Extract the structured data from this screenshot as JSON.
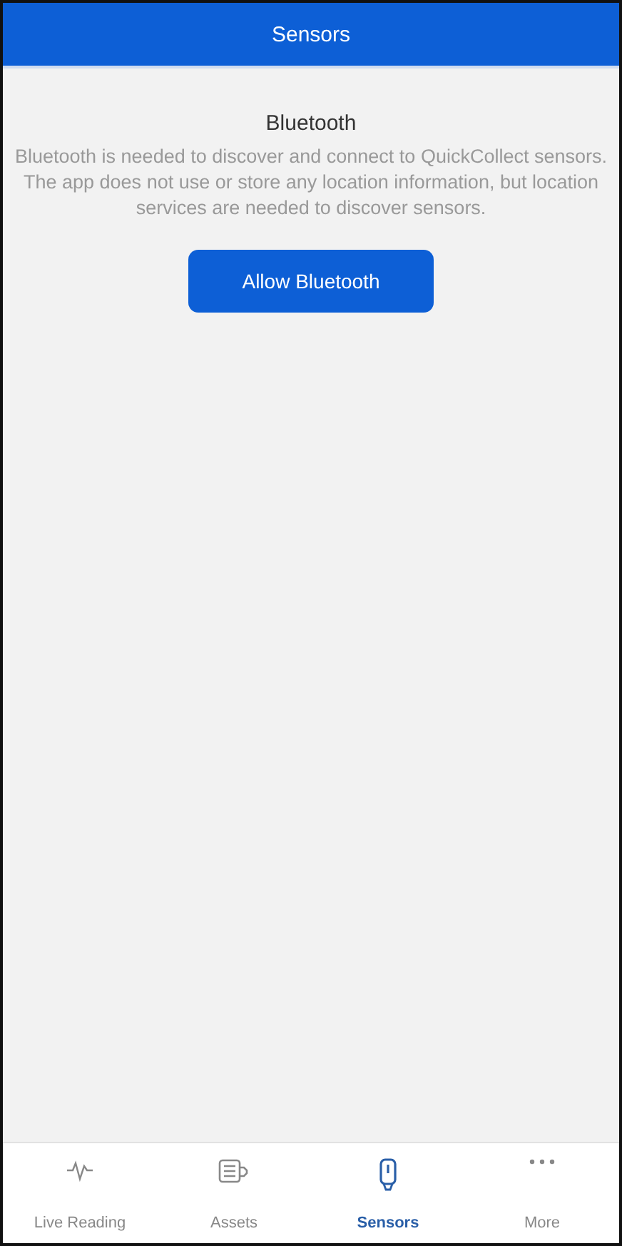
{
  "header": {
    "title": "Sensors"
  },
  "prompt": {
    "title": "Bluetooth",
    "message": "Bluetooth is needed to discover and connect to QuickCollect sensors. The app does not use or store any location information, but location services are needed to discover sensors.",
    "button": "Allow Bluetooth"
  },
  "tabs": [
    {
      "label": "Live Reading",
      "kind": "pulse",
      "selected": false
    },
    {
      "label": "Assets",
      "kind": "motor",
      "selected": false
    },
    {
      "label": "Sensors",
      "kind": "sensor",
      "selected": true
    },
    {
      "label": "More",
      "kind": "more",
      "selected": false
    }
  ]
}
